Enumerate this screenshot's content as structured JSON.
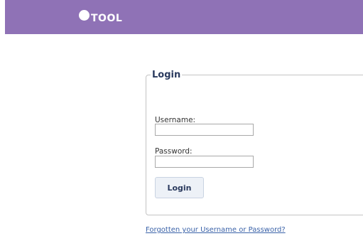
{
  "header": {
    "logo_text": "TOOL",
    "background_color": "#8f72b6"
  },
  "login": {
    "legend": "Login",
    "username_label": "Username:",
    "username_value": "",
    "password_label": "Password:",
    "password_value": "",
    "submit_label": "Login"
  },
  "links": {
    "forgot": "Forgotten your Username or Password?"
  }
}
